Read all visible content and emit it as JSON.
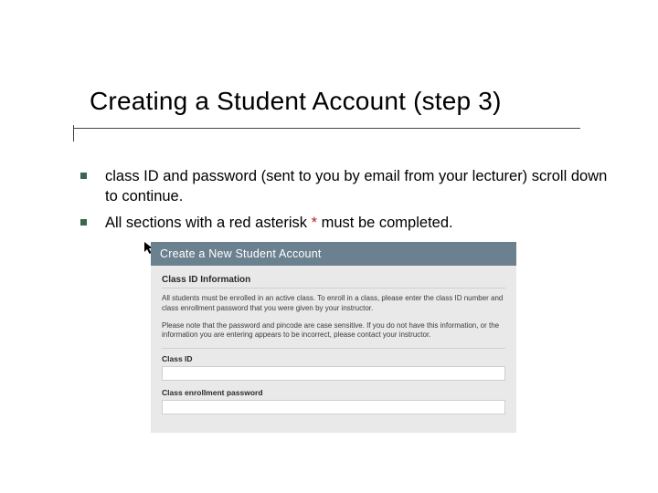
{
  "title": "Creating a Student Account (step 3)",
  "bullets": [
    "class ID and password (sent to you by email from your lecturer) scroll down to continue.",
    {
      "pre": "All sections with a red asterisk ",
      "ast": "*",
      "post": " must be completed."
    }
  ],
  "embedded": {
    "header": "Create a New Student Account",
    "section_title": "Class ID Information",
    "para1": "All students must be enrolled in an active class. To enroll in a class, please enter the class ID number and class enrollment password that you were given by your instructor.",
    "para2": "Please note that the password and pincode are case sensitive. If you do not have this information, or the information you are entering appears to be incorrect, please contact your instructor.",
    "label_class_id": "Class ID",
    "label_enroll_pw": "Class enrollment password"
  }
}
